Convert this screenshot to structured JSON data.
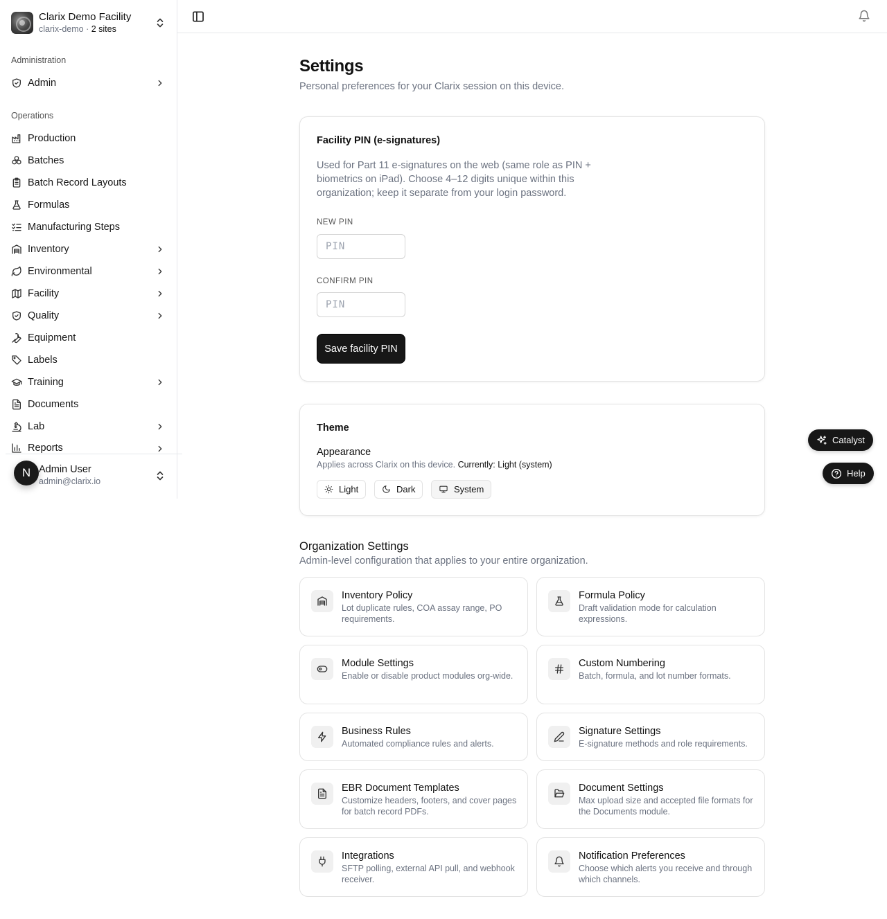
{
  "sidebar": {
    "org": {
      "name": "Clarix Demo Facility",
      "slug": "clarix-demo",
      "separator": " · ",
      "sites": "2 sites"
    },
    "sections": [
      {
        "label": "Administration",
        "items": [
          {
            "label": "Admin",
            "icon": "shield-check-icon",
            "expandable": true
          }
        ]
      },
      {
        "label": "Operations",
        "items": [
          {
            "label": "Production",
            "icon": "factory-icon",
            "expandable": false
          },
          {
            "label": "Batches",
            "icon": "boxes-icon",
            "expandable": false
          },
          {
            "label": "Batch Record Layouts",
            "icon": "clipboard-list-icon",
            "expandable": false
          },
          {
            "label": "Formulas",
            "icon": "flask-icon",
            "expandable": false
          },
          {
            "label": "Manufacturing Steps",
            "icon": "list-checks-icon",
            "expandable": false
          },
          {
            "label": "Inventory",
            "icon": "warehouse-icon",
            "expandable": true
          },
          {
            "label": "Environmental",
            "icon": "leaf-icon",
            "expandable": true
          },
          {
            "label": "Facility",
            "icon": "map-icon",
            "expandable": true
          },
          {
            "label": "Quality",
            "icon": "shield-check-icon",
            "expandable": true
          },
          {
            "label": "Equipment",
            "icon": "wrench-icon",
            "expandable": false
          },
          {
            "label": "Labels",
            "icon": "tag-icon",
            "expandable": false
          },
          {
            "label": "Training",
            "icon": "graduation-cap-icon",
            "expandable": true
          },
          {
            "label": "Documents",
            "icon": "file-text-icon",
            "expandable": false
          },
          {
            "label": "Lab",
            "icon": "microscope-icon",
            "expandable": true
          },
          {
            "label": "Reports",
            "icon": "bar-chart-icon",
            "expandable": true
          }
        ]
      }
    ],
    "user": {
      "initial": "N",
      "name": "Admin User",
      "email": "admin@clarix.io"
    }
  },
  "main": {
    "title": "Settings",
    "subtitle": "Personal preferences for your Clarix session on this device.",
    "pin_card": {
      "title": "Facility PIN (e-signatures)",
      "description": "Used for Part 11 e-signatures on the web (same role as PIN + biometrics on iPad). Choose 4–12 digits unique within this organization; keep it separate from your login password.",
      "new_pin_label": "NEW PIN",
      "new_pin_placeholder": "PIN",
      "confirm_pin_label": "CONFIRM PIN",
      "confirm_pin_placeholder": "PIN",
      "save_label": "Save facility PIN"
    },
    "theme_card": {
      "title": "Theme",
      "appearance_label": "Appearance",
      "appearance_desc": "Applies across Clarix on this device.",
      "current": "Currently: Light (system)",
      "options": [
        {
          "label": "Light",
          "icon": "sun-icon"
        },
        {
          "label": "Dark",
          "icon": "moon-icon"
        },
        {
          "label": "System",
          "icon": "monitor-icon"
        }
      ],
      "selected": "System"
    },
    "org_settings": {
      "title": "Organization Settings",
      "description": "Admin-level configuration that applies to your entire organization.",
      "tiles": [
        {
          "title": "Inventory Policy",
          "desc": "Lot duplicate rules, COA assay range, PO requirements.",
          "icon": "warehouse-icon"
        },
        {
          "title": "Formula Policy",
          "desc": "Draft validation mode for calculation expressions.",
          "icon": "flask-icon"
        },
        {
          "title": "Module Settings",
          "desc": "Enable or disable product modules org-wide.",
          "icon": "toggle-icon"
        },
        {
          "title": "Custom Numbering",
          "desc": "Batch, formula, and lot number formats.",
          "icon": "hash-icon"
        },
        {
          "title": "Business Rules",
          "desc": "Automated compliance rules and alerts.",
          "icon": "zap-icon"
        },
        {
          "title": "Signature Settings",
          "desc": "E-signature methods and role requirements.",
          "icon": "pen-icon"
        },
        {
          "title": "EBR Document Templates",
          "desc": "Customize headers, footers, and cover pages for batch record PDFs.",
          "icon": "file-text-icon"
        },
        {
          "title": "Document Settings",
          "desc": "Max upload size and accepted file formats for the Documents module.",
          "icon": "folder-open-icon"
        },
        {
          "title": "Integrations",
          "desc": "SFTP polling, external API pull, and webhook receiver.",
          "icon": "plug-icon"
        },
        {
          "title": "Notification Preferences",
          "desc": "Choose which alerts you receive and through which channels.",
          "icon": "bell-icon"
        }
      ]
    }
  },
  "floating": {
    "catalyst_label": "Catalyst",
    "help_label": "Help"
  }
}
